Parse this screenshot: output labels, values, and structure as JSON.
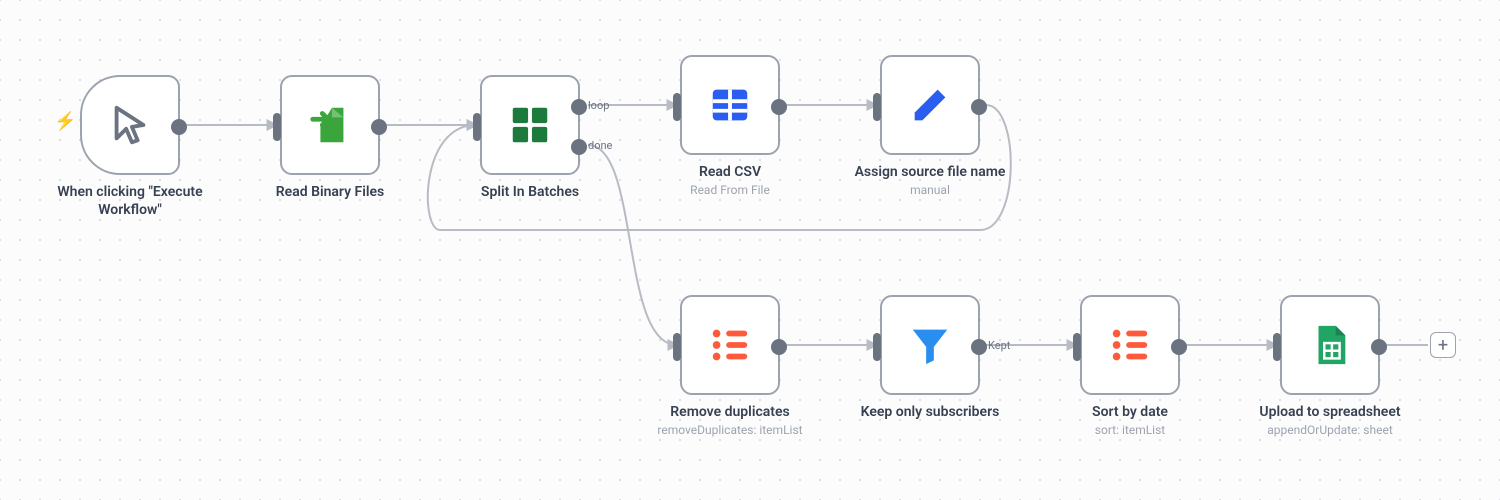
{
  "nodes": {
    "trigger": {
      "label": "When clicking \"Execute Workflow\""
    },
    "readBinary": {
      "label": "Read Binary Files"
    },
    "splitBatches": {
      "label": "Split In Batches",
      "port_loop": "loop",
      "port_done": "done"
    },
    "readCsv": {
      "label": "Read CSV",
      "sublabel": "Read From File"
    },
    "assignSource": {
      "label": "Assign source file name",
      "sublabel": "manual"
    },
    "removeDup": {
      "label": "Remove duplicates",
      "sublabel": "removeDuplicates: itemList"
    },
    "keepSub": {
      "label": "Keep only subscribers",
      "port_kept": "Kept"
    },
    "sortDate": {
      "label": "Sort by date",
      "sublabel": "sort: itemList"
    },
    "upload": {
      "label": "Upload to spreadsheet",
      "sublabel": "appendOrUpdate: sheet"
    }
  },
  "addButton": "+"
}
